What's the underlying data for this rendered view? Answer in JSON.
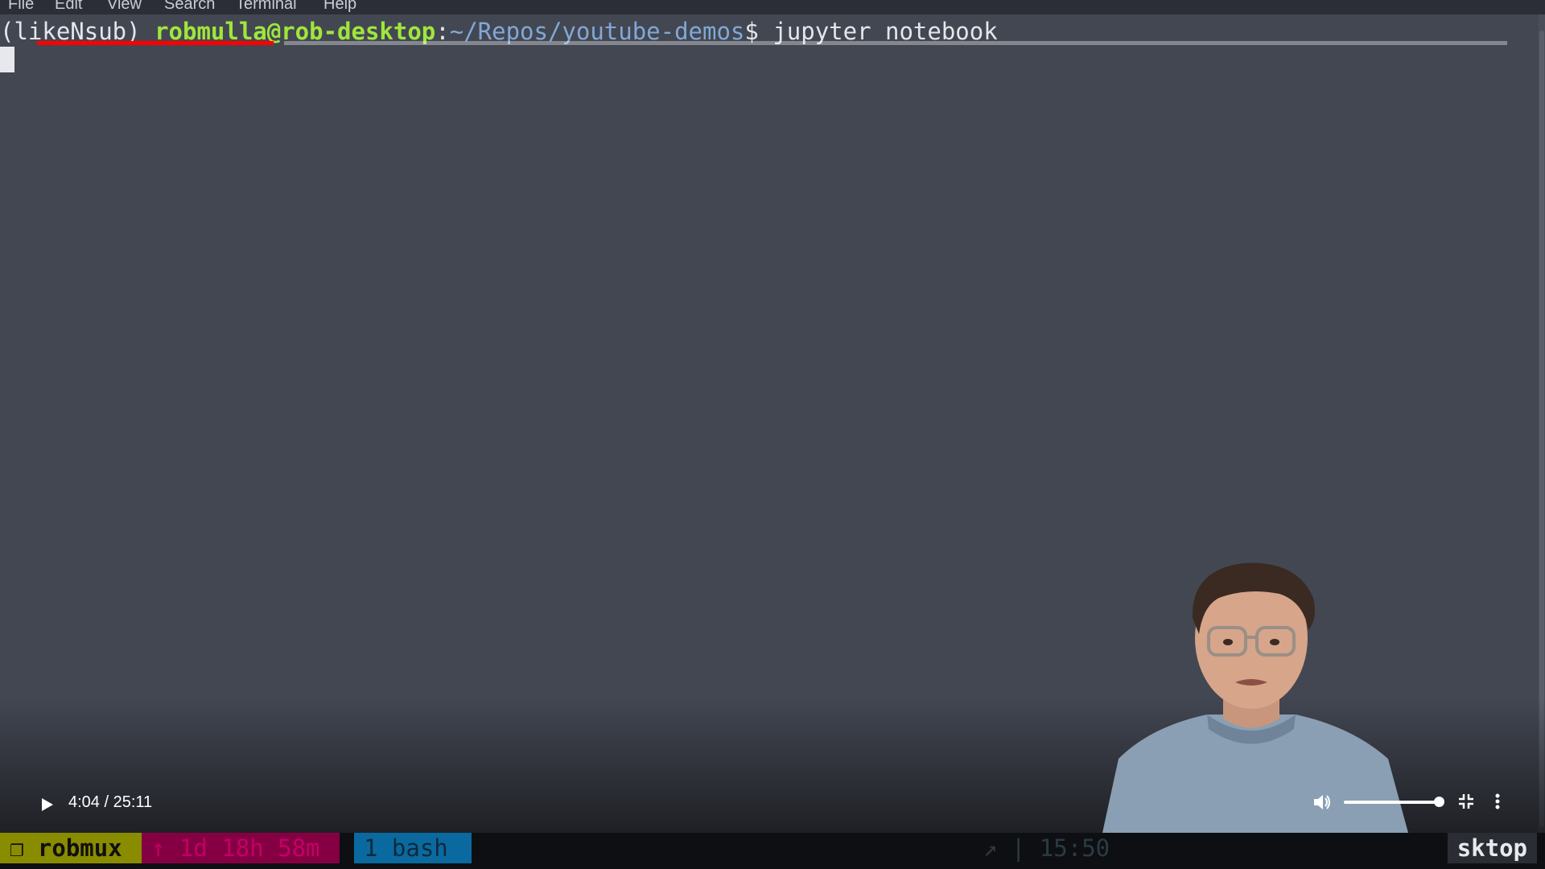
{
  "menubar": {
    "items": [
      "File",
      "Edit",
      "View",
      "Search",
      "Terminal",
      "Help"
    ]
  },
  "terminal": {
    "env": "(likeNsub) ",
    "user_host": "robmulla@rob-desktop",
    "separator": ":",
    "path": "~/Repos/youtube-demos",
    "prompt_symbol": "$ ",
    "command": "jupyter notebook"
  },
  "player": {
    "time": "4:04 / 25:11",
    "progress_fraction": 0.161,
    "volume_fraction": 0.9,
    "colors": {
      "played": "#ff0000",
      "controls": "#ffffff"
    }
  },
  "statusbar": {
    "session": "❐ robmux",
    "uptime": "↑ 1d 18h 58m",
    "window": "1 bash",
    "clock": "↗ | 15:50",
    "host": "sktop"
  },
  "icons": {
    "play": "play-icon",
    "volume": "volume-icon",
    "exit_fullscreen": "exit-fullscreen-icon",
    "more": "more-vertical-icon"
  }
}
